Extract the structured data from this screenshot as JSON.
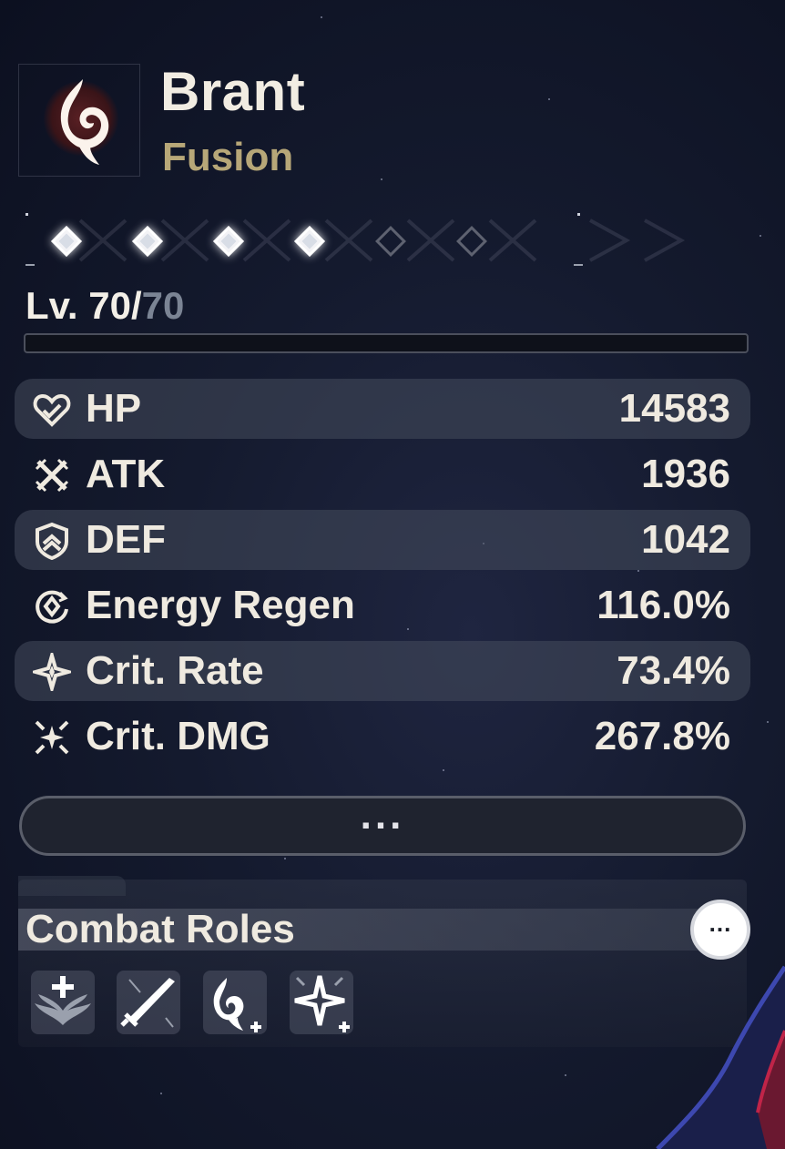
{
  "character": {
    "name": "Brant",
    "element": "Fusion",
    "element_icon": "fusion-flame-icon"
  },
  "sequence": {
    "unlocked": 4,
    "total": 6
  },
  "level": {
    "current": "70",
    "separator": "/",
    "max": "70",
    "prefix": "Lv. ",
    "progress": 0
  },
  "stats": [
    {
      "label": "HP",
      "value": "14583",
      "icon": "hp-heart-icon"
    },
    {
      "label": "ATK",
      "value": "1936",
      "icon": "atk-crossed-swords-icon"
    },
    {
      "label": "DEF",
      "value": "1042",
      "icon": "def-shield-icon"
    },
    {
      "label": "Energy Regen",
      "value": "116.0%",
      "icon": "energy-regen-icon"
    },
    {
      "label": "Crit. Rate",
      "value": "73.4%",
      "icon": "crit-rate-star-icon"
    },
    {
      "label": "Crit. DMG",
      "value": "267.8%",
      "icon": "crit-dmg-burst-icon"
    }
  ],
  "more_button": {
    "label": "..."
  },
  "combat_roles": {
    "title": "Combat Roles",
    "info_button_label": "...",
    "roles": [
      {
        "icon": "healer-wings-icon"
      },
      {
        "icon": "sword-attack-icon"
      },
      {
        "icon": "fusion-amplify-icon"
      },
      {
        "icon": "crit-amplify-icon"
      }
    ]
  },
  "colors": {
    "element": "#b7a778",
    "text": "#efeae0",
    "level_max": "#7b8494",
    "row_shade": "#464c5c"
  }
}
